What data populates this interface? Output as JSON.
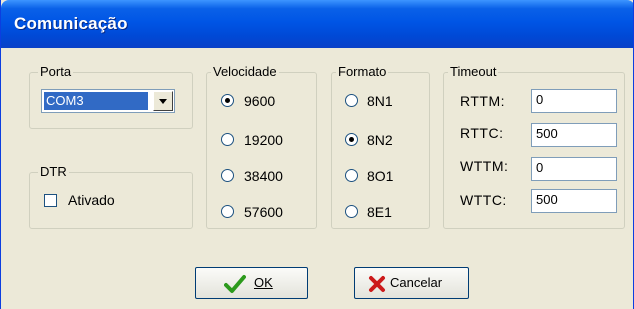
{
  "window": {
    "title": "Comunicação"
  },
  "porta": {
    "legend": "Porta",
    "selected": "COM3"
  },
  "dtr": {
    "legend": "DTR",
    "checkbox_label": "Ativado",
    "checked": false
  },
  "velocidade": {
    "legend": "Velocidade",
    "options": [
      "9600",
      "19200",
      "38400",
      "57600"
    ],
    "selected": "9600"
  },
  "formato": {
    "legend": "Formato",
    "options": [
      "8N1",
      "8N2",
      "8O1",
      "8E1"
    ],
    "selected": "8N2"
  },
  "timeout": {
    "legend": "Timeout",
    "fields": [
      {
        "label": "RTTM:",
        "value": "0"
      },
      {
        "label": "RTTC:",
        "value": "500"
      },
      {
        "label": "WTTM:",
        "value": "0"
      },
      {
        "label": "WTTC:",
        "value": "500"
      }
    ]
  },
  "buttons": {
    "ok_label": "OK",
    "cancel_label": "Cancelar"
  },
  "icons": {
    "ok": "checkmark-icon",
    "cancel": "x-icon"
  },
  "colors": {
    "title_bar": "#0055e5",
    "dialog_bg": "#ece9d8",
    "ok_green": "#2c9a1c",
    "cancel_red": "#cc1a1a"
  }
}
